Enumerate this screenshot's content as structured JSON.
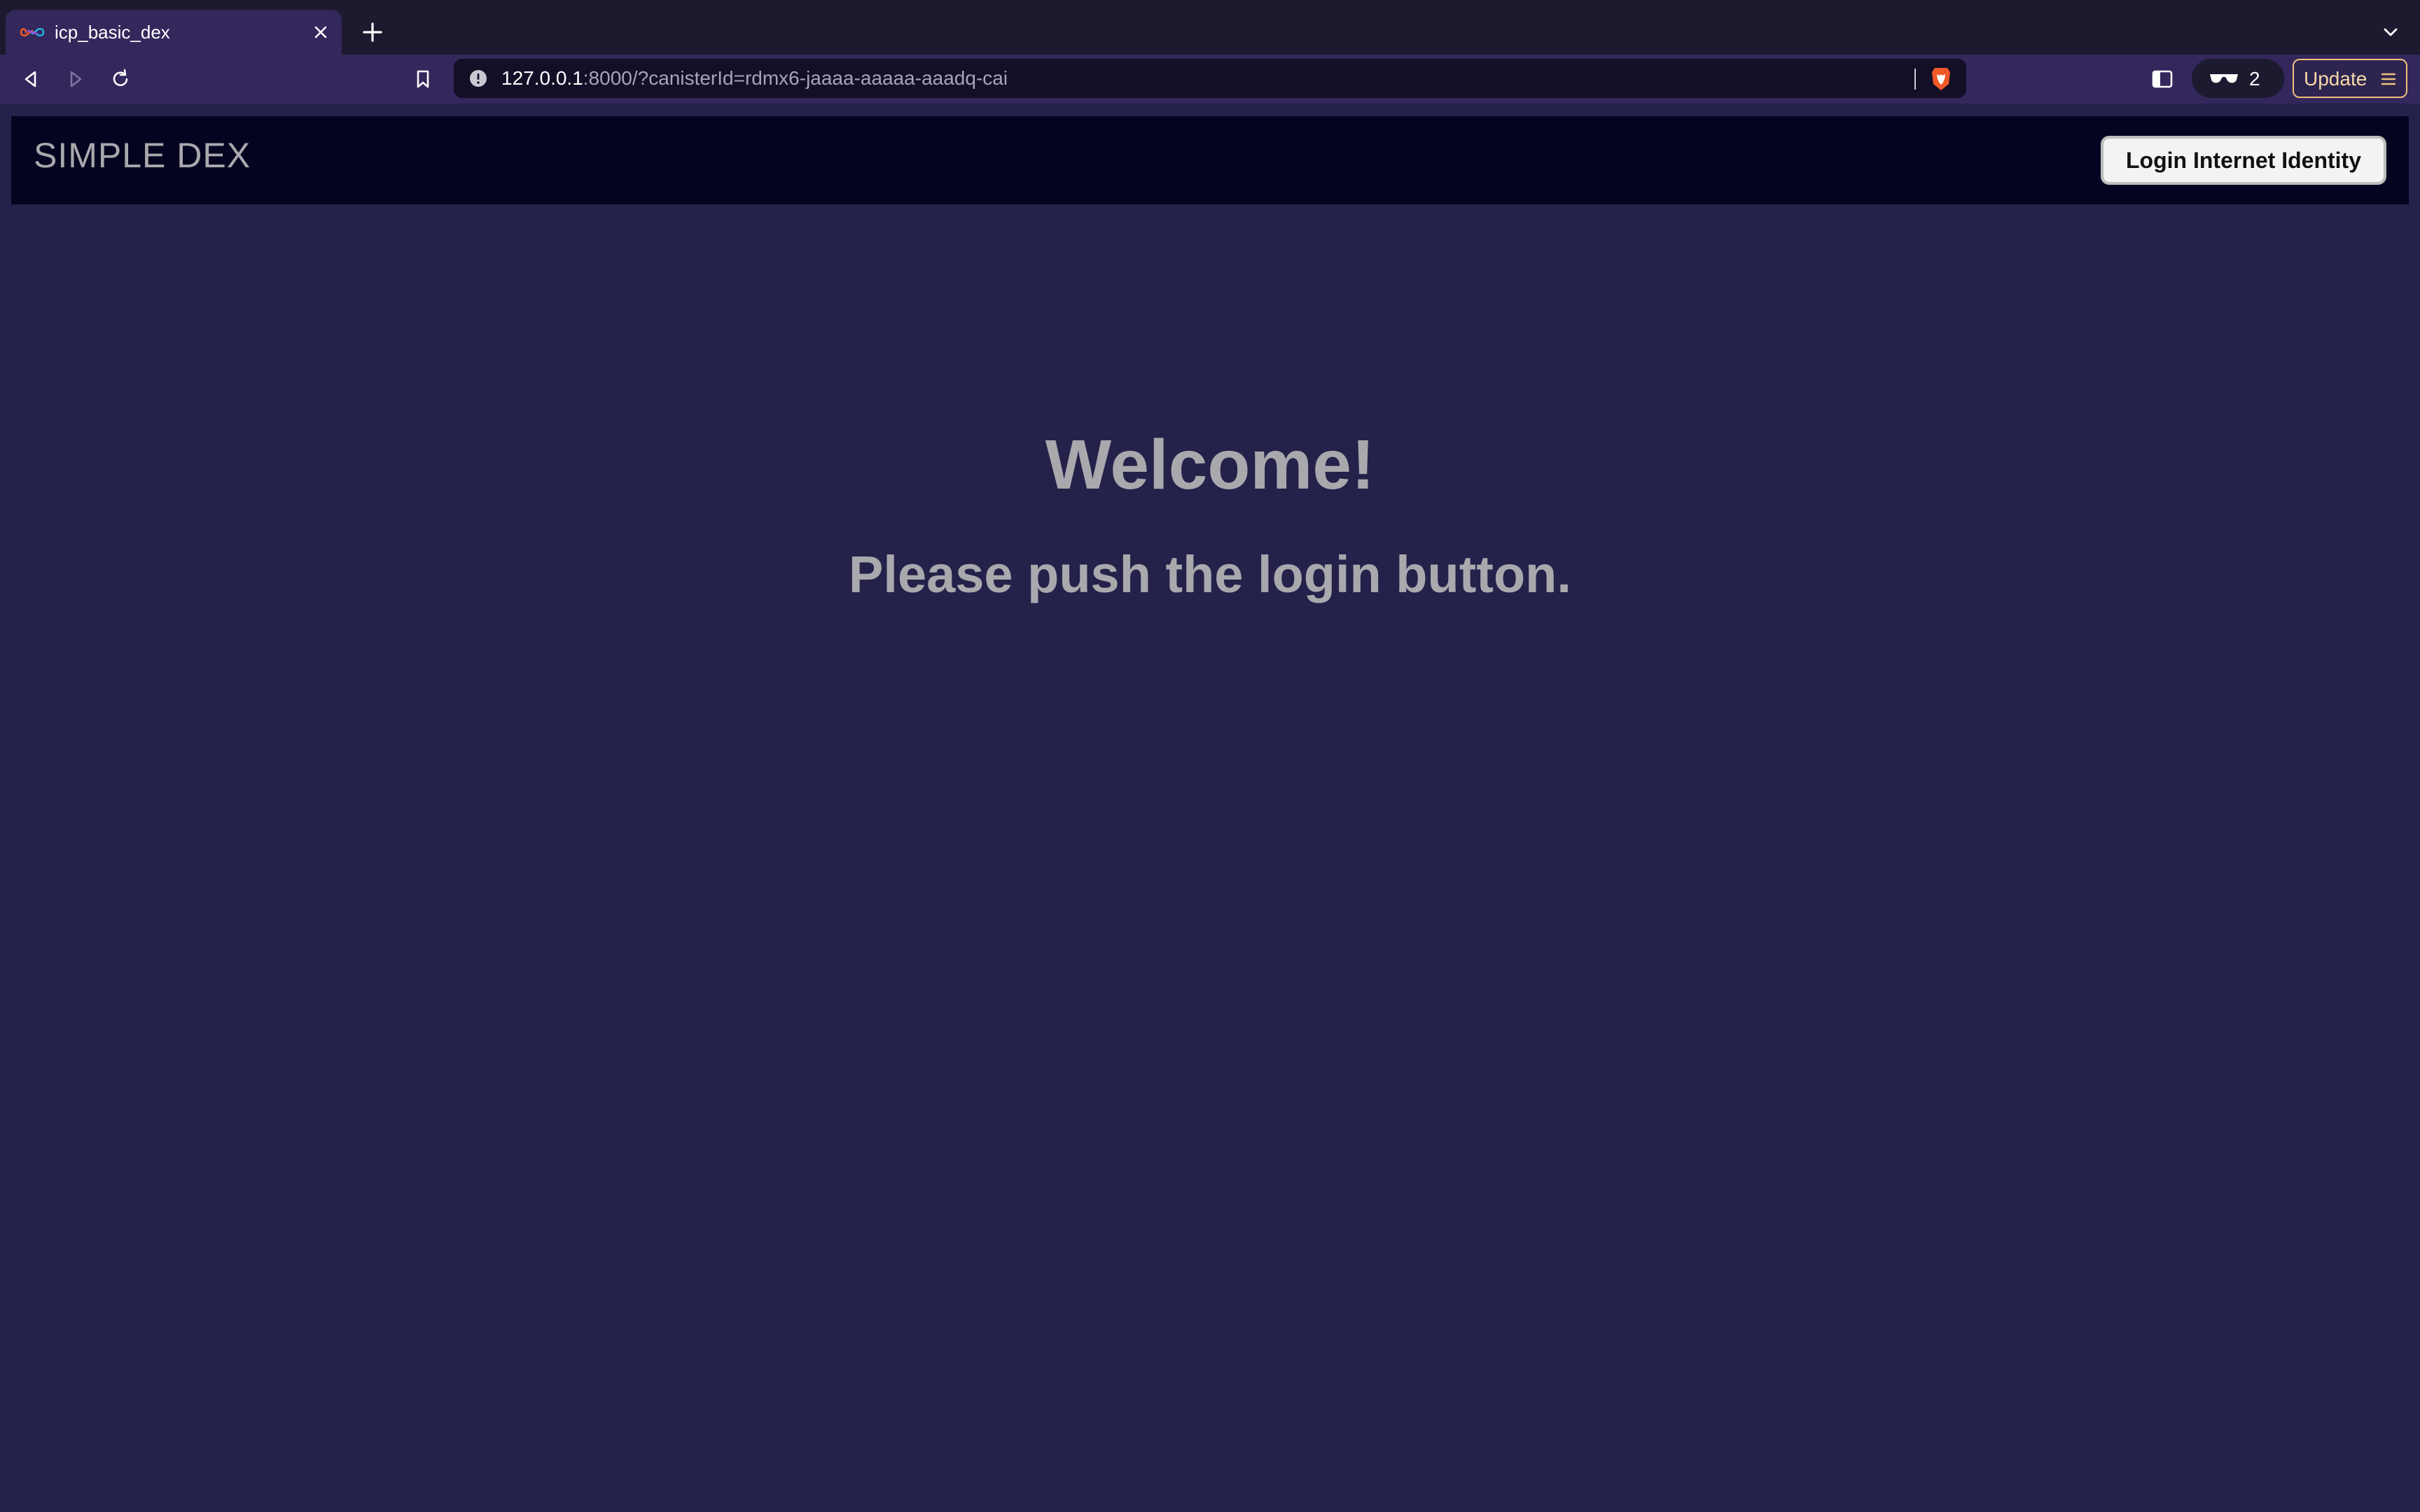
{
  "browser": {
    "tab": {
      "title": "icp_basic_dex",
      "favicon": "infinity-icon"
    },
    "address_bar": {
      "host": "127.0.0.1",
      "rest": ":8000/?canisterId=rdmx6-jaaaa-aaaaa-aaadq-cai"
    },
    "toolbar_icons": [
      "back-icon",
      "forward-icon",
      "reload-icon",
      "bookmark-icon",
      "info-icon",
      "brave-shield-icon",
      "sidebar-icon",
      "glasses-icon",
      "menu-icon"
    ],
    "shields_count": "2",
    "update_label": "Update",
    "colors": {
      "tabstrip": "#1c1a2e",
      "toolbar": "#33275c",
      "urlbar": "#120f26",
      "update_border": "#f0c27a",
      "brave_orange": "#f05a28"
    }
  },
  "app": {
    "title": "SIMPLE DEX",
    "login_button": "Login Internet Identity",
    "welcome": "Welcome!",
    "subtitle": "Please push the login button.",
    "colors": {
      "page_bg": "#24224a",
      "header_bg": "#050420",
      "text": "#a9a8ad"
    }
  }
}
